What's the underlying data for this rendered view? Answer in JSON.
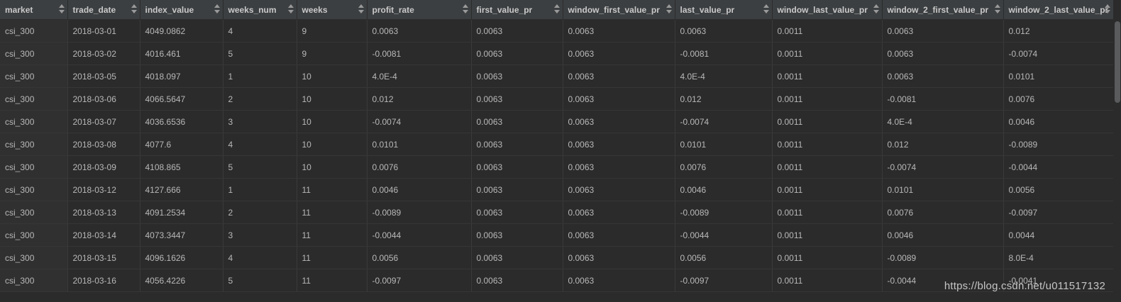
{
  "columns": [
    "market",
    "trade_date",
    "index_value",
    "weeks_num",
    "weeks",
    "profit_rate",
    "first_value_pr",
    "window_first_value_pr",
    "last_value_pr",
    "window_last_value_pr",
    "window_2_first_value_pr",
    "window_2_last_value_pr"
  ],
  "rows": [
    [
      "csi_300",
      "2018-03-01",
      "4049.0862",
      "4",
      "9",
      "0.0063",
      "0.0063",
      "0.0063",
      "0.0063",
      "0.0011",
      "0.0063",
      "0.012"
    ],
    [
      "csi_300",
      "2018-03-02",
      "4016.461",
      "5",
      "9",
      "-0.0081",
      "0.0063",
      "0.0063",
      "-0.0081",
      "0.0011",
      "0.0063",
      "-0.0074"
    ],
    [
      "csi_300",
      "2018-03-05",
      "4018.097",
      "1",
      "10",
      "4.0E-4",
      "0.0063",
      "0.0063",
      "4.0E-4",
      "0.0011",
      "0.0063",
      "0.0101"
    ],
    [
      "csi_300",
      "2018-03-06",
      "4066.5647",
      "2",
      "10",
      "0.012",
      "0.0063",
      "0.0063",
      "0.012",
      "0.0011",
      "-0.0081",
      "0.0076"
    ],
    [
      "csi_300",
      "2018-03-07",
      "4036.6536",
      "3",
      "10",
      "-0.0074",
      "0.0063",
      "0.0063",
      "-0.0074",
      "0.0011",
      "4.0E-4",
      "0.0046"
    ],
    [
      "csi_300",
      "2018-03-08",
      "4077.6",
      "4",
      "10",
      "0.0101",
      "0.0063",
      "0.0063",
      "0.0101",
      "0.0011",
      "0.012",
      "-0.0089"
    ],
    [
      "csi_300",
      "2018-03-09",
      "4108.865",
      "5",
      "10",
      "0.0076",
      "0.0063",
      "0.0063",
      "0.0076",
      "0.0011",
      "-0.0074",
      "-0.0044"
    ],
    [
      "csi_300",
      "2018-03-12",
      "4127.666",
      "1",
      "11",
      "0.0046",
      "0.0063",
      "0.0063",
      "0.0046",
      "0.0011",
      "0.0101",
      "0.0056"
    ],
    [
      "csi_300",
      "2018-03-13",
      "4091.2534",
      "2",
      "11",
      "-0.0089",
      "0.0063",
      "0.0063",
      "-0.0089",
      "0.0011",
      "0.0076",
      "-0.0097"
    ],
    [
      "csi_300",
      "2018-03-14",
      "4073.3447",
      "3",
      "11",
      "-0.0044",
      "0.0063",
      "0.0063",
      "-0.0044",
      "0.0011",
      "0.0046",
      "0.0044"
    ],
    [
      "csi_300",
      "2018-03-15",
      "4096.1626",
      "4",
      "11",
      "0.0056",
      "0.0063",
      "0.0063",
      "0.0056",
      "0.0011",
      "-0.0089",
      "8.0E-4"
    ],
    [
      "csi_300",
      "2018-03-16",
      "4056.4226",
      "5",
      "11",
      "-0.0097",
      "0.0063",
      "0.0063",
      "-0.0097",
      "0.0011",
      "-0.0044",
      "-0.0041"
    ]
  ],
  "watermark": "https://blog.csdn.net/u011517132",
  "icons": {
    "sort": "sort-arrows-icon"
  },
  "colors": {
    "background": "#2b2b2b",
    "header": "#3c3f41",
    "text": "#bbbbbb"
  }
}
